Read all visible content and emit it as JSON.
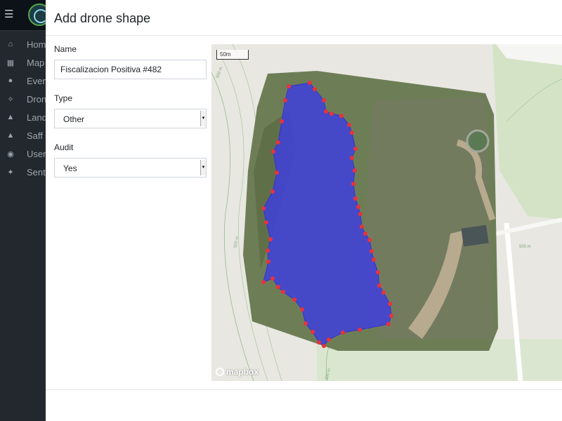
{
  "sidebar": {
    "items": [
      {
        "label": "Home",
        "icon": "home-icon"
      },
      {
        "label": "Map",
        "icon": "map-icon"
      },
      {
        "label": "Events",
        "icon": "alert-icon"
      },
      {
        "label": "Drones",
        "icon": "drone-icon"
      },
      {
        "label": "Land",
        "icon": "land-icon"
      },
      {
        "label": "Saff",
        "icon": "tree-icon"
      },
      {
        "label": "Users",
        "icon": "users-icon"
      },
      {
        "label": "Sentinel",
        "icon": "satellite-icon"
      }
    ]
  },
  "modal": {
    "title": "Add drone shape",
    "name_label": "Name",
    "name_value": "Fiscalizacion Positiva #482",
    "type_label": "Type",
    "type_value": "Other",
    "audit_label": "Audit",
    "audit_value": "Yes"
  },
  "map": {
    "scale_label": "50m",
    "attribution": "mapbox",
    "contour_labels": [
      "500 m",
      "500 m",
      "500 m",
      "500 m"
    ],
    "polygon_fill": "#3d3de0",
    "vertex_color": "#e8323c"
  }
}
